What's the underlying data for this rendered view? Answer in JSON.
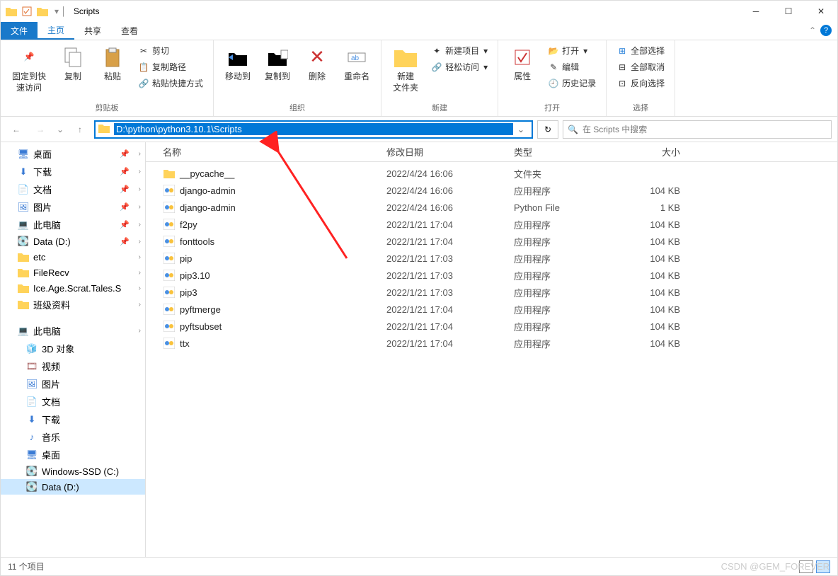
{
  "titlebar": {
    "title": "Scripts"
  },
  "tabs": {
    "file": "文件",
    "home": "主页",
    "share": "共享",
    "view": "查看"
  },
  "ribbon": {
    "clipboard": {
      "label": "剪贴板",
      "pin": "固定到快\n速访问",
      "copy": "复制",
      "paste": "粘贴",
      "cut": "剪切",
      "copypath": "复制路径",
      "pasteshortcut": "粘贴快捷方式"
    },
    "organize": {
      "label": "组织",
      "moveto": "移动到",
      "copyto": "复制到",
      "delete": "删除",
      "rename": "重命名"
    },
    "new": {
      "label": "新建",
      "newfolder": "新建\n文件夹",
      "newitem": "新建项目",
      "easyaccess": "轻松访问"
    },
    "open": {
      "label": "打开",
      "properties": "属性",
      "open": "打开",
      "edit": "编辑",
      "history": "历史记录"
    },
    "select": {
      "label": "选择",
      "selectall": "全部选择",
      "selectnone": "全部取消",
      "invert": "反向选择"
    }
  },
  "addressbar": {
    "path": "D:\\python\\python3.10.1\\Scripts"
  },
  "search": {
    "placeholder": "在 Scripts 中搜索"
  },
  "columns": {
    "name": "名称",
    "date": "修改日期",
    "type": "类型",
    "size": "大小"
  },
  "nav": {
    "quick": [
      {
        "label": "桌面",
        "icon": "desktop",
        "pinned": true
      },
      {
        "label": "下载",
        "icon": "download",
        "pinned": true
      },
      {
        "label": "文档",
        "icon": "document",
        "pinned": true
      },
      {
        "label": "图片",
        "icon": "picture",
        "pinned": true
      },
      {
        "label": "此电脑",
        "icon": "pc",
        "pinned": true
      },
      {
        "label": "Data (D:)",
        "icon": "disk",
        "pinned": true
      },
      {
        "label": "etc",
        "icon": "folder",
        "pinned": false
      },
      {
        "label": "FileRecv",
        "icon": "folder",
        "pinned": false
      },
      {
        "label": "Ice.Age.Scrat.Tales.S",
        "icon": "folder",
        "pinned": false
      },
      {
        "label": "班级资料",
        "icon": "folder",
        "pinned": false
      }
    ],
    "thispc_label": "此电脑",
    "thispc": [
      {
        "label": "3D 对象",
        "icon": "3d"
      },
      {
        "label": "视频",
        "icon": "video"
      },
      {
        "label": "图片",
        "icon": "picture"
      },
      {
        "label": "文档",
        "icon": "document"
      },
      {
        "label": "下载",
        "icon": "download"
      },
      {
        "label": "音乐",
        "icon": "music"
      },
      {
        "label": "桌面",
        "icon": "desktop"
      },
      {
        "label": "Windows-SSD (C:)",
        "icon": "disk"
      },
      {
        "label": "Data (D:)",
        "icon": "disk",
        "selected": true
      }
    ]
  },
  "files": [
    {
      "name": "__pycache__",
      "date": "2022/4/24 16:06",
      "type": "文件夹",
      "size": "",
      "icon": "folder"
    },
    {
      "name": "django-admin",
      "date": "2022/4/24 16:06",
      "type": "应用程序",
      "size": "104 KB",
      "icon": "app"
    },
    {
      "name": "django-admin",
      "date": "2022/4/24 16:06",
      "type": "Python File",
      "size": "1 KB",
      "icon": "py"
    },
    {
      "name": "f2py",
      "date": "2022/1/21 17:04",
      "type": "应用程序",
      "size": "104 KB",
      "icon": "app"
    },
    {
      "name": "fonttools",
      "date": "2022/1/21 17:04",
      "type": "应用程序",
      "size": "104 KB",
      "icon": "app"
    },
    {
      "name": "pip",
      "date": "2022/1/21 17:03",
      "type": "应用程序",
      "size": "104 KB",
      "icon": "app"
    },
    {
      "name": "pip3.10",
      "date": "2022/1/21 17:03",
      "type": "应用程序",
      "size": "104 KB",
      "icon": "app"
    },
    {
      "name": "pip3",
      "date": "2022/1/21 17:03",
      "type": "应用程序",
      "size": "104 KB",
      "icon": "app"
    },
    {
      "name": "pyftmerge",
      "date": "2022/1/21 17:04",
      "type": "应用程序",
      "size": "104 KB",
      "icon": "app"
    },
    {
      "name": "pyftsubset",
      "date": "2022/1/21 17:04",
      "type": "应用程序",
      "size": "104 KB",
      "icon": "app"
    },
    {
      "name": "ttx",
      "date": "2022/1/21 17:04",
      "type": "应用程序",
      "size": "104 KB",
      "icon": "app"
    }
  ],
  "status": {
    "items": "11 个项目"
  },
  "watermark": "CSDN @GEM_FOREVER"
}
